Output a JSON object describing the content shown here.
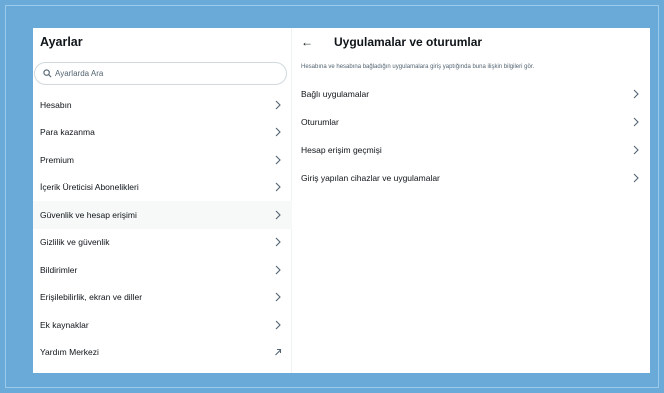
{
  "settings": {
    "title": "Ayarlar",
    "search_placeholder": "Ayarlarda Ara",
    "menu": [
      {
        "label": "Hesabın",
        "icon": "chevron-right-icon"
      },
      {
        "label": "Para kazanma",
        "icon": "chevron-right-icon"
      },
      {
        "label": "Premium",
        "icon": "chevron-right-icon"
      },
      {
        "label": "İçerik Üreticisi Abonelikleri",
        "icon": "chevron-right-icon"
      },
      {
        "label": "Güvenlik ve hesap erişimi",
        "icon": "chevron-right-icon",
        "active": true
      },
      {
        "label": "Gizlilik ve güvenlik",
        "icon": "chevron-right-icon"
      },
      {
        "label": "Bildirimler",
        "icon": "chevron-right-icon"
      },
      {
        "label": "Erişilebilirlik, ekran ve diller",
        "icon": "chevron-right-icon"
      },
      {
        "label": "Ek kaynaklar",
        "icon": "chevron-right-icon"
      },
      {
        "label": "Yardım Merkezi",
        "icon": "external-link-icon"
      }
    ]
  },
  "detail": {
    "back_icon": "←",
    "title": "Uygulamalar ve oturumlar",
    "description": "Hesabına ve hesabına bağladığın uygulamalara giriş yaptığında buna ilişkin bilgileri gör.",
    "options": [
      {
        "label": "Bağlı uygulamalar"
      },
      {
        "label": "Oturumlar"
      },
      {
        "label": "Hesap erişim geçmişi"
      },
      {
        "label": "Giriş yapılan cihazlar ve uygulamalar"
      }
    ]
  },
  "colors": {
    "background": "#6aaad9",
    "panel": "#ffffff",
    "text": "#0f1419",
    "muted": "#536471",
    "active_row": "#f7f9f9"
  }
}
